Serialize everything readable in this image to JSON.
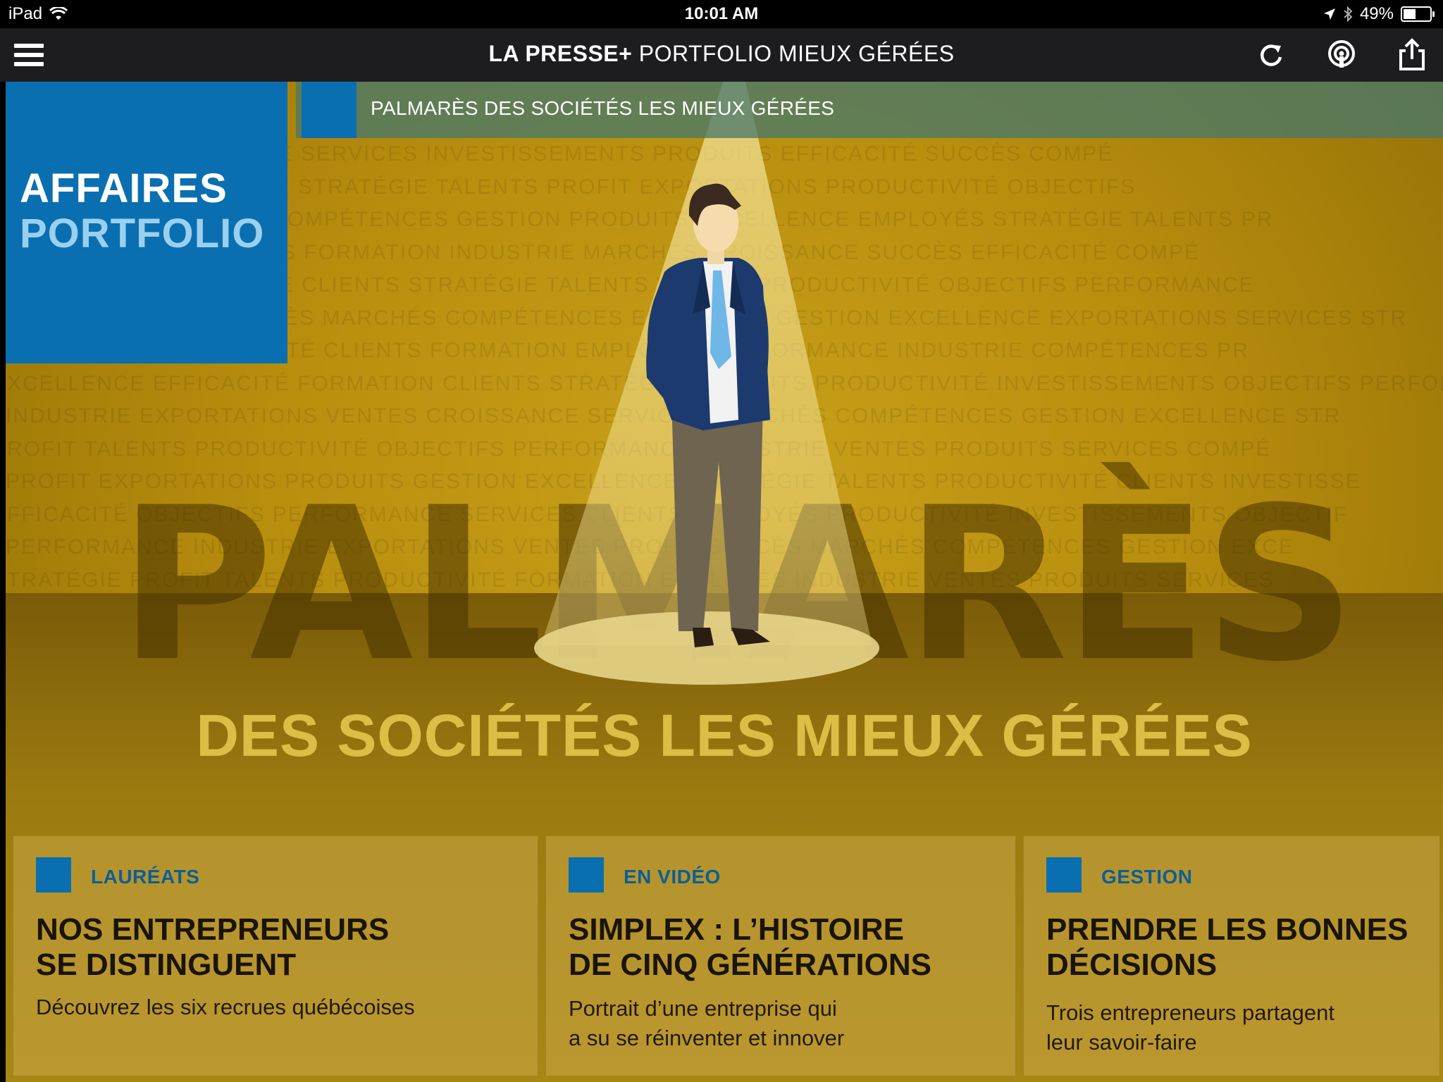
{
  "status_bar": {
    "device": "iPad",
    "time": "10:01 AM",
    "battery": "49%",
    "battery_level": 0.49
  },
  "nav": {
    "brand": "LA PRESSE+",
    "title": "PORTFOLIO MIEUX GÉRÉES",
    "icons": [
      "menu-icon",
      "refresh-icon",
      "podcast-icon",
      "share-icon"
    ]
  },
  "breadcrumb": "PALMARÈS DES SOCIÉTÉS LES MIEUX GÉRÉES",
  "section_badge": {
    "line1": "AFFAIRES",
    "line2": "PORTFOLIO"
  },
  "hero": {
    "big_word": "PALMARÈS",
    "subtitle": "DES SOCIÉTÉS LES MIEUX GÉRÉES",
    "wall_lines": [
      "INDUSTRIE  CROISSANCE  SERVICES  INVESTISSEMENTS  PRODUITS  EFFICACITÉ  SUCCÈS  COMPÉ",
      "FORMATION  EXCELLENCE  STRATÉGIE  TALENTS  PROFIT  EXPORTATIONS  PRODUCTIVITÉ  OBJECTIFS",
      "CROISSANCE SUCCÈS COMPÉTENCES GESTION PRODUITS  EXCELLENCE  EMPLOYÉS STRATÉGIE TALENTS  PR",
      "PERFORMANCE  SERVICES  FORMATION  INDUSTRIE  MARCHÉS  CROISSANCE SUCCÈS  EFFICACITÉ  COMPÉ",
      "EMPLOYÉS  EXCELLENCE  CLIENTS  STRATÉGIE  TALENTS  VENTES  PRODUCTIVITÉ  OBJECTIFS  PERFORMANCE",
      "INVESTISSEMENTS  SUCCÈS  MARCHÉS  COMPÉTENCES  EFFICACITÉ  GESTION  EXCELLENCE  EXPORTATIONS  SERVICES  STR",
      "OBJECTIFS  PRODUCTIVITÉ  CLIENTS  FORMATION  EMPLOYÉS  PERFORMANCE  INDUSTRIE  COMPÉTENCES  PR",
      "EXCELLENCE  EFFICACITÉ  FORMATION  CLIENTS  STRATÉGIE  PRODUITS  PRODUCTIVITÉ  INVESTISSEMENTS  OBJECTIFS  PERFOR",
      "INDUSTRIE  EXPORTATIONS  VENTES  CROISSANCE  SERVICES  MARCHÉS  COMPÉTENCES  GESTION  EXCELLENCE  STR",
      "PROFIT  TALENTS  PRODUCTIVITÉ  OBJECTIFS  PERFORMANCE  INDUSTRIE  VENTES  PRODUITS  SERVICES  COMPÉ",
      "PROFIT  EXPORTATIONS  PRODUITS  GESTION  EXCELLENCE  STRATÉGIE  TALENTS  PRODUCTIVITÉ  CLIENTS  INVESTISSE",
      "EFFICACITÉ  OBJECTIFS  PERFORMANCE  SERVICES  CLIENTS  EMPLOYÉS  PRODUCTIVITÉ  INVESTISSEMENTS  OBJECTIF",
      "PERFORMANCE  INDUSTRIE  EXPORTATIONS  VENTES  PROFIT  SUCCÈS  MARCHÉS  COMPÉTENCES  GESTION  EXCE",
      "STRATÉGIE  PROFIT  TALENTS  PRODUCTIVITÉ  FORMATION  EMPLOYÉS  INDUSTRIE  VENTES  PRODUITS  SERVICES"
    ]
  },
  "cards": [
    {
      "kicker": "LAURÉATS",
      "headline_1": "NOS ENTREPRENEURS",
      "headline_2": "SE DISTINGUENT",
      "desc_1": "Découvrez les six recrues québécoises",
      "desc_2": ""
    },
    {
      "kicker": "EN VIDÉO",
      "headline_1": "SIMPLEX : L’HISTOIRE",
      "headline_2": "DE CINQ GÉNÉRATIONS",
      "desc_1": "Portrait d’une entreprise qui",
      "desc_2": "a su se réinventer et innover"
    },
    {
      "kicker": "GESTION",
      "headline_1": "PRENDRE LES BONNES",
      "headline_2": "DÉCISIONS",
      "desc_1": "Trois entrepreneurs partagent",
      "desc_2": "leur savoir-faire"
    }
  ],
  "colors": {
    "accent_blue": "#0a6fb0",
    "badge_light_blue": "#9ad0ef",
    "gold": "#b88e0e",
    "subtitle_gold": "#dcbd46",
    "nav_bg": "#1d1d1f"
  }
}
